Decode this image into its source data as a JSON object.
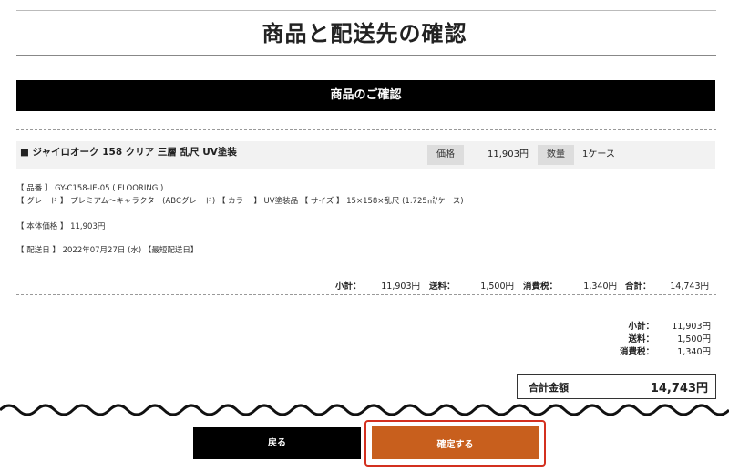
{
  "page": {
    "title": "商品と配送先の確認"
  },
  "section": {
    "title": "商品のご確認"
  },
  "product": {
    "name": "■ ジャイロオーク 158 クリア 三層 乱尺 UV塗装",
    "price_label": "価格",
    "price_value": "11,903円",
    "qty_label": "数量",
    "qty_value": "1ケース"
  },
  "details": {
    "line1": "【 品番 】 GY-C158-IE-05 ( FLOORING )",
    "line2": "【 グレード 】 プレミアム～キャラクター(ABCグレード) 【 カラー 】 UV塗装品 【 サイズ 】 15×158×乱尺 (1.725㎡/ケース)",
    "line3": "【 本体価格 】 11,903円",
    "line4": "【 配送日 】 2022年07月27日 (水) 【最短配送日】"
  },
  "summary": {
    "subtotal_label": "小計：",
    "subtotal_value": "11,903円",
    "shipping_label": "送料：",
    "shipping_value": "1,500円",
    "tax_label": "消費税：",
    "tax_value": "1,340円",
    "total_label": "合計：",
    "total_value": "14,743円"
  },
  "totals": {
    "subtotal_label": "小計：",
    "subtotal_value": "11,903円",
    "shipping_label": "送料：",
    "shipping_value": "1,500円",
    "tax_label": "消費税：",
    "tax_value": "1,340円",
    "grand_label": "合計金額",
    "grand_value": "14,743円"
  },
  "buttons": {
    "back": "戻る",
    "confirm": "確定する"
  },
  "colors": {
    "confirm_bg": "#c85f1d",
    "highlight_border": "#d3301f",
    "section_bar": "#000000"
  }
}
